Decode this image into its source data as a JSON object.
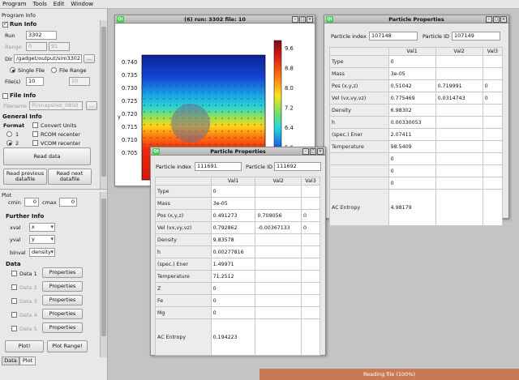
{
  "menu": [
    "Program",
    "Tools",
    "Edit",
    "Window"
  ],
  "left": {
    "tab_info": "Program Info",
    "run_info": {
      "title": "Run Info",
      "run_label": "Run",
      "run_value": "3302",
      "range_label": "Range",
      "range_from": "0",
      "range_to": "91"
    },
    "dir": {
      "label": "Dir",
      "value": "/gadget/output/sim3302",
      "browse": "..."
    },
    "single_file": "Single File",
    "file_range": "File Range",
    "files_label": "File(s)",
    "files_value": "10",
    "files_range_end": "10",
    "file_info": {
      "title": "File Info",
      "filename_label": "Filename",
      "filename_value": "lfi/snapshot_0850",
      "browse": "..."
    },
    "general_info": {
      "title": "General Info",
      "format_label": "Format",
      "opt1": "1",
      "opt2": "2",
      "convert_units": "Convert Units",
      "rcom": "RCOM recenter",
      "vcom": "VCOM recenter"
    },
    "read_data": "Read data",
    "read_prev": "Read previous datafile",
    "read_next": "Read next datafile",
    "plot": {
      "title": "Plot",
      "cmin_label": "cmin",
      "cmin_value": "0",
      "cmax_label": "cmax",
      "cmax_value": "0",
      "further": "Further Info",
      "xval_label": "xval",
      "xval_value": "x",
      "yval_label": "yval",
      "yval_value": "y",
      "binval_label": "binval",
      "binval_value": "density",
      "data_title": "Data",
      "data": [
        "Data 1",
        "Data 2",
        "Data 3",
        "Data 4",
        "Data 5"
      ],
      "properties": "Properties",
      "plot_btn": "Plot!",
      "plot_range_btn": "Plot Range!"
    },
    "tabs": [
      "Data",
      "Plot"
    ]
  },
  "plot_window": {
    "title": "(6) run: 3302 file: 10",
    "yticks": [
      "0.740",
      "0.735",
      "0.730",
      "0.725",
      "0.720",
      "0.715",
      "0.710",
      "0.705"
    ],
    "ylabel": "y",
    "cticks": [
      "9.6",
      "8.8",
      "8.0",
      "7.2",
      "6.4",
      "5.6",
      "4.8"
    ]
  },
  "props_back": {
    "title": "Particle Properties",
    "index_label": "Particle index",
    "index_value": "107148",
    "id_label": "Particle ID",
    "id_value": "107149",
    "cols": [
      "Val1",
      "Val2",
      "Val3"
    ],
    "rows": [
      {
        "k": "Type",
        "v": [
          "0",
          "",
          ""
        ]
      },
      {
        "k": "Mass",
        "v": [
          "3e-05",
          "",
          ""
        ]
      },
      {
        "k": "Pos (x,y,z)",
        "v": [
          "0.51042",
          "0.719991",
          "0"
        ]
      },
      {
        "k": "Vel (vx,vy,vz)",
        "v": [
          "0.775469",
          "0.0314743",
          "0"
        ]
      },
      {
        "k": "Density",
        "v": [
          "6.98302",
          "",
          ""
        ]
      },
      {
        "k": "h",
        "v": [
          "0.00330053",
          "",
          ""
        ]
      },
      {
        "k": "(spec.) Ener",
        "v": [
          "2.07411",
          "",
          ""
        ]
      },
      {
        "k": "Temperature",
        "v": [
          "98.5409",
          "",
          ""
        ]
      },
      {
        "k": "",
        "v": [
          "0",
          "",
          ""
        ]
      },
      {
        "k": "",
        "v": [
          "0",
          "",
          ""
        ]
      },
      {
        "k": "",
        "v": [
          "0",
          "",
          ""
        ]
      },
      {
        "k": "AC Entropy",
        "v": [
          "4.98179",
          "",
          ""
        ]
      }
    ]
  },
  "props_front": {
    "title": "Particle Properties",
    "index_label": "Particle index",
    "index_value": "111691",
    "id_label": "Particle ID",
    "id_value": "111692",
    "cols": [
      "Val1",
      "Val2",
      "Val3"
    ],
    "rows": [
      {
        "k": "Type",
        "v": [
          "0",
          "",
          ""
        ]
      },
      {
        "k": "Mass",
        "v": [
          "3e-05",
          "",
          ""
        ]
      },
      {
        "k": "Pos (x,y,z)",
        "v": [
          "0.491273",
          "0.709056",
          "0"
        ]
      },
      {
        "k": "Vel (vx,vy,vz)",
        "v": [
          "0.792862",
          "-0.00367133",
          "0"
        ]
      },
      {
        "k": "Density",
        "v": [
          "9.83578",
          "",
          ""
        ]
      },
      {
        "k": "h",
        "v": [
          "0.00277816",
          "",
          ""
        ]
      },
      {
        "k": "(spec.) Ener",
        "v": [
          "1.49971",
          "",
          ""
        ]
      },
      {
        "k": "Temperature",
        "v": [
          "71.2512",
          "",
          ""
        ]
      },
      {
        "k": "Z",
        "v": [
          "0",
          "",
          ""
        ]
      },
      {
        "k": "Fe",
        "v": [
          "0",
          "",
          ""
        ]
      },
      {
        "k": "Mg",
        "v": [
          "0",
          "",
          ""
        ]
      },
      {
        "k": "AC Entropy",
        "v": [
          "0.194223",
          "",
          ""
        ]
      }
    ]
  },
  "status": "Reading file (100%)",
  "colors": {
    "status_bg": "#c87a55",
    "qt_green": "#41cd52",
    "check_red": "#b01010"
  }
}
